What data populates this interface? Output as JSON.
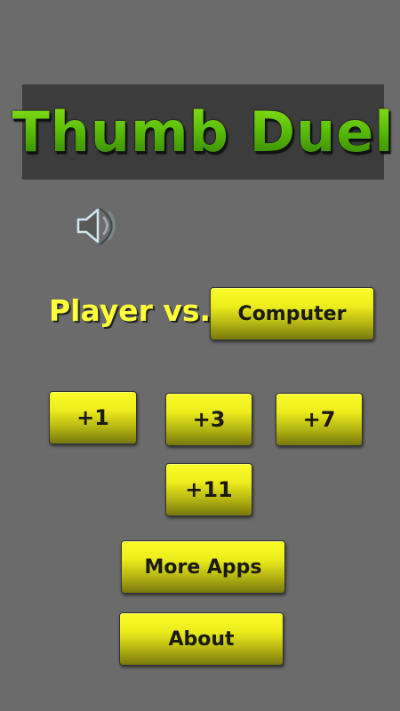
{
  "title": "Thumb Duel",
  "sound": {
    "icon": "speaker-icon"
  },
  "player_label": "Player vs.",
  "opponent_button": "Computer",
  "increment_buttons": [
    "+1",
    "+3",
    "+7",
    "+11"
  ],
  "more_apps_button": "More Apps",
  "about_button": "About",
  "colors": {
    "background": "#6b6b6b",
    "title_banner": "#3c3c3c",
    "title_green": "#66cc0a",
    "label_yellow": "#ffff3a",
    "button_yellow": "#eded1d"
  }
}
